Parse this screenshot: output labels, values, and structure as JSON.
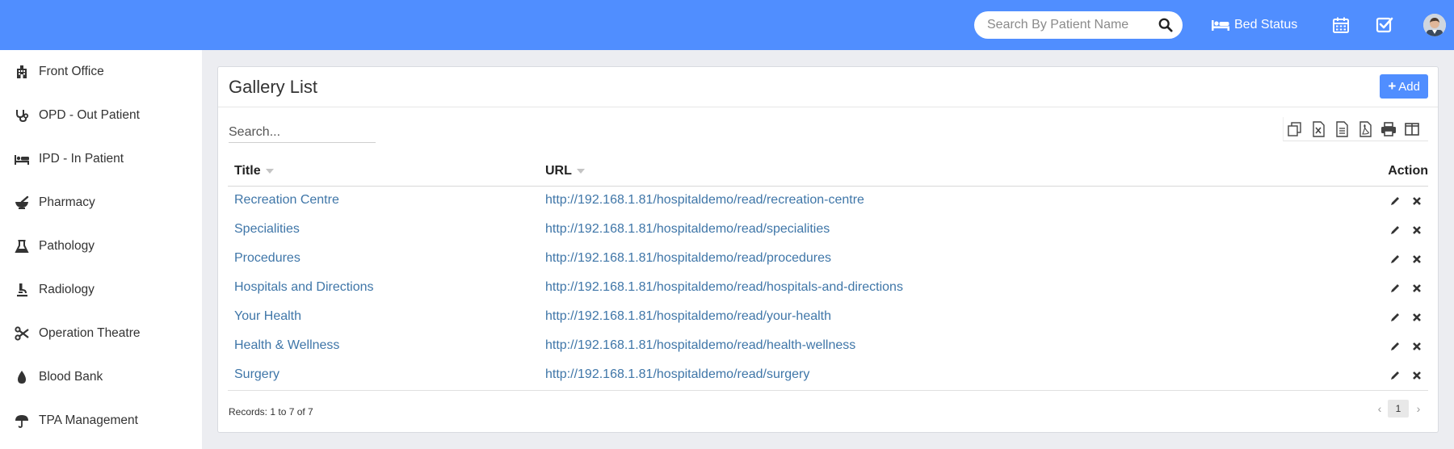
{
  "header": {
    "search_placeholder": "Search By Patient Name",
    "bed_status_label": "Bed Status",
    "accent_color": "#508eff"
  },
  "sidebar": {
    "items": [
      {
        "label": "Front Office",
        "icon": "building-icon"
      },
      {
        "label": "OPD - Out Patient",
        "icon": "stethoscope-icon"
      },
      {
        "label": "IPD - In Patient",
        "icon": "bed-icon"
      },
      {
        "label": "Pharmacy",
        "icon": "mortar-pestle-icon"
      },
      {
        "label": "Pathology",
        "icon": "flask-icon"
      },
      {
        "label": "Radiology",
        "icon": "microscope-icon"
      },
      {
        "label": "Operation Theatre",
        "icon": "scissors-icon"
      },
      {
        "label": "Blood Bank",
        "icon": "blood-drop-icon"
      },
      {
        "label": "TPA Management",
        "icon": "umbrella-icon"
      }
    ]
  },
  "panel": {
    "title": "Gallery List",
    "add_label": "Add",
    "search_placeholder": "Search...",
    "toolbar_icons": [
      "copy-icon",
      "excel-icon",
      "csv-icon",
      "pdf-icon",
      "print-icon",
      "columns-icon"
    ]
  },
  "table": {
    "columns": {
      "title": "Title",
      "url": "URL",
      "action": "Action"
    },
    "rows": [
      {
        "title": "Recreation Centre",
        "url": "http://192.168.1.81/hospitaldemo/read/recreation-centre"
      },
      {
        "title": "Specialities",
        "url": "http://192.168.1.81/hospitaldemo/read/specialities"
      },
      {
        "title": "Procedures",
        "url": "http://192.168.1.81/hospitaldemo/read/procedures"
      },
      {
        "title": "Hospitals and Directions",
        "url": "http://192.168.1.81/hospitaldemo/read/hospitals-and-directions"
      },
      {
        "title": "Your Health",
        "url": "http://192.168.1.81/hospitaldemo/read/your-health"
      },
      {
        "title": "Health & Wellness",
        "url": "http://192.168.1.81/hospitaldemo/read/health-wellness"
      },
      {
        "title": "Surgery",
        "url": "http://192.168.1.81/hospitaldemo/read/surgery"
      }
    ]
  },
  "footer": {
    "records_text": "Records: 1 to 7 of 7",
    "prev": "‹",
    "current_page": "1",
    "next": "›"
  }
}
